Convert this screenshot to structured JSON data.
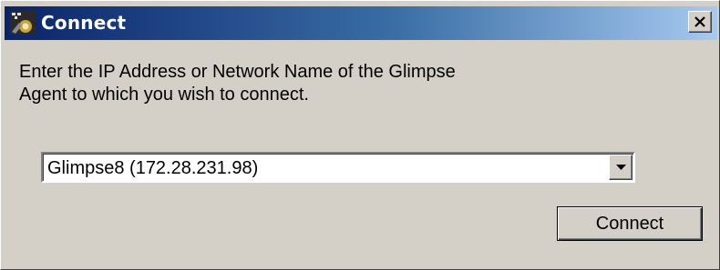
{
  "window": {
    "title": "Connect",
    "close_label": "✕"
  },
  "dialog": {
    "prompt_line1": "Enter the IP Address or Network Name of the Glimpse",
    "prompt_line2": "Agent to which you wish to connect.",
    "agent_select": {
      "selected_value": "Glimpse8 (172.28.231.98)"
    },
    "connect_label": "Connect"
  },
  "colors": {
    "titlebar_start": "#0a246a",
    "titlebar_end": "#a6caf0",
    "face": "#d4d0c8"
  },
  "icons": {
    "app": "glimpse-app-icon",
    "close": "close-icon",
    "dropdown": "chevron-down-icon"
  }
}
